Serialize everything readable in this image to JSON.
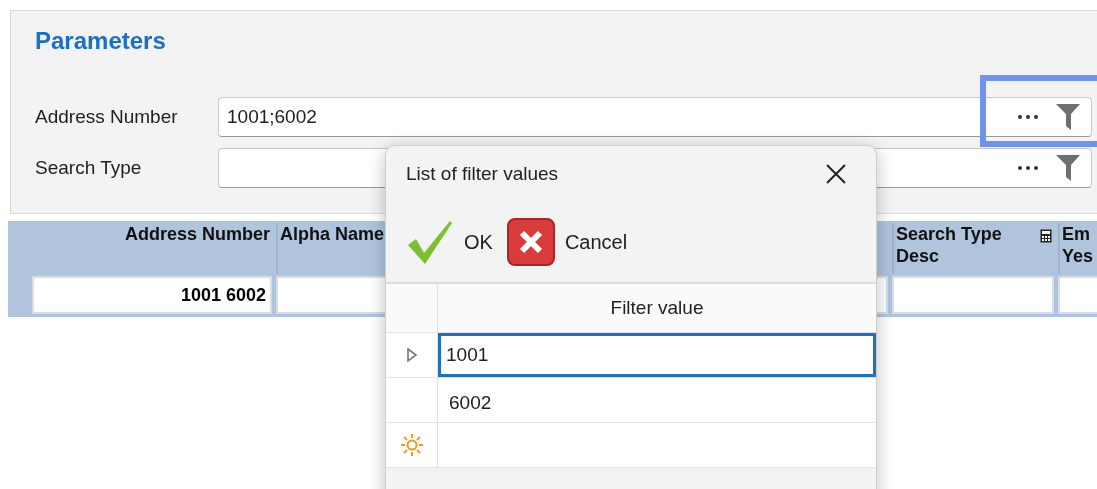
{
  "parameters": {
    "title": "Parameters",
    "fields": [
      {
        "label": "Address Number",
        "value": "1001;6002",
        "highlighted": true
      },
      {
        "label": "Search Type",
        "highlighted": false
      }
    ]
  },
  "results_grid": {
    "columns": [
      {
        "label": "Address Number",
        "summary": false
      },
      {
        "label": "Alpha Name"
      },
      {
        "label": "Search Type Desc",
        "summary": true
      },
      {
        "label": "Em Yes"
      }
    ],
    "rows": [
      {
        "address_number": "1001 6002"
      }
    ]
  },
  "dialog": {
    "title": "List of filter values",
    "buttons": [
      {
        "kind": "ok",
        "label": "OK"
      },
      {
        "kind": "cancel",
        "label": "Cancel"
      }
    ],
    "column": "Filter value",
    "rows": [
      {
        "value": "1001",
        "selected": true
      },
      {
        "value": "6002",
        "selected": false
      }
    ],
    "new_row": true
  }
}
